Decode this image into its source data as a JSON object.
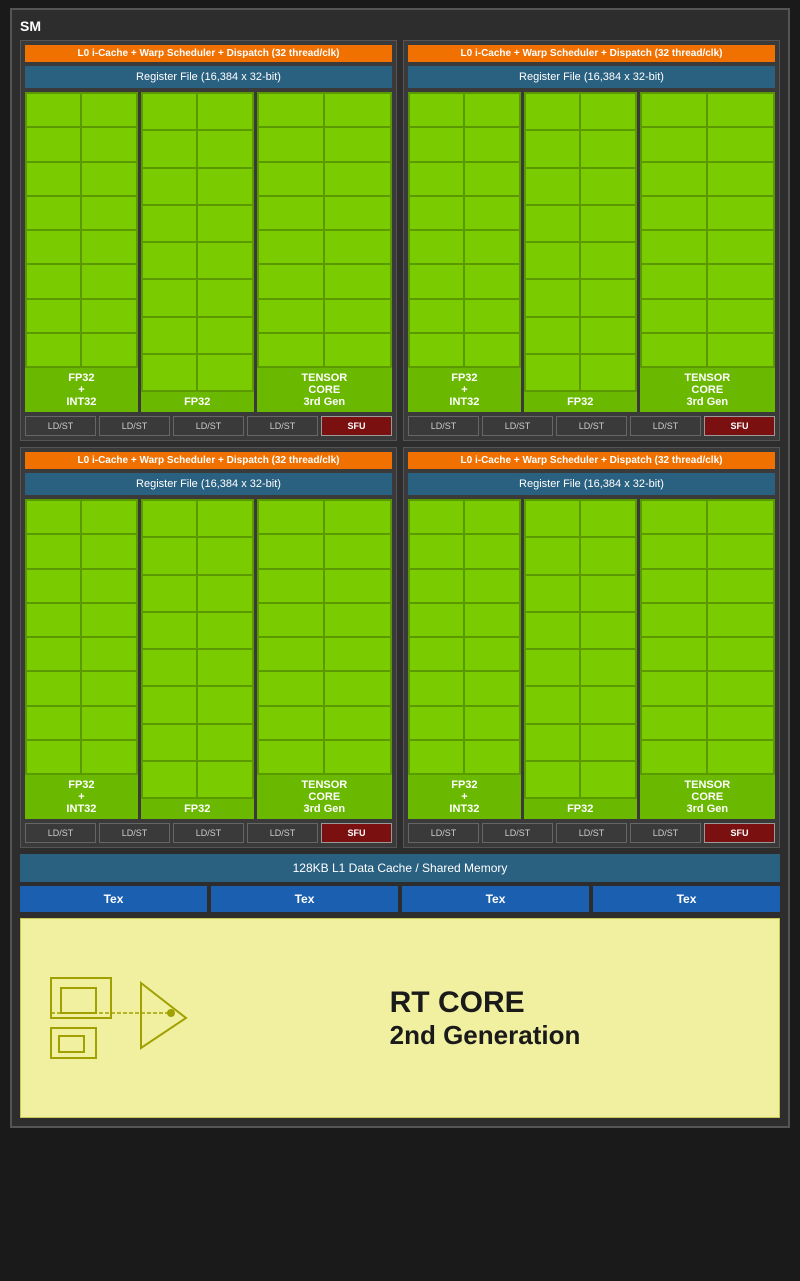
{
  "sm": {
    "label": "SM",
    "quadrants": [
      {
        "id": "q1",
        "l0_cache": "L0 i-Cache + Warp Scheduler + Dispatch (32 thread/clk)",
        "register_file": "Register File (16,384 x 32-bit)",
        "fp32_int32_label": "FP32\n+\nINT32",
        "fp32_label": "FP32",
        "tensor_label": "TENSOR\nCORE\n3rd Gen",
        "ld_st_units": [
          "LD/ST",
          "LD/ST",
          "LD/ST",
          "LD/ST"
        ],
        "sfu_label": "SFU"
      },
      {
        "id": "q2",
        "l0_cache": "L0 i-Cache + Warp Scheduler + Dispatch (32 thread/clk)",
        "register_file": "Register File (16,384 x 32-bit)",
        "fp32_int32_label": "FP32\n+\nINT32",
        "fp32_label": "FP32",
        "tensor_label": "TENSOR\nCORE\n3rd Gen",
        "ld_st_units": [
          "LD/ST",
          "LD/ST",
          "LD/ST",
          "LD/ST"
        ],
        "sfu_label": "SFU"
      },
      {
        "id": "q3",
        "l0_cache": "L0 i-Cache + Warp Scheduler + Dispatch (32 thread/clk)",
        "register_file": "Register File (16,384 x 32-bit)",
        "fp32_int32_label": "FP32\n+\nINT32",
        "fp32_label": "FP32",
        "tensor_label": "TENSOR\nCORE\n3rd Gen",
        "ld_st_units": [
          "LD/ST",
          "LD/ST",
          "LD/ST",
          "LD/ST"
        ],
        "sfu_label": "SFU"
      },
      {
        "id": "q4",
        "l0_cache": "L0 i-Cache + Warp Scheduler + Dispatch (32 thread/clk)",
        "register_file": "Register File (16,384 x 32-bit)",
        "fp32_int32_label": "FP32\n+\nINT32",
        "fp32_label": "FP32",
        "tensor_label": "TENSOR\nCORE\n3rd Gen",
        "ld_st_units": [
          "LD/ST",
          "LD/ST",
          "LD/ST",
          "LD/ST"
        ],
        "sfu_label": "SFU"
      }
    ],
    "l1_cache": "128KB L1 Data Cache / Shared Memory",
    "tex_units": [
      "Tex",
      "Tex",
      "Tex",
      "Tex"
    ],
    "rt_core": {
      "line1": "RT CORE",
      "line2": "2nd Generation"
    }
  }
}
